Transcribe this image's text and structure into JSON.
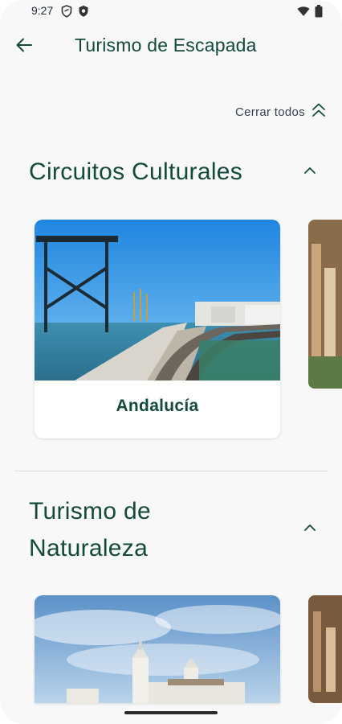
{
  "status_bar": {
    "time": "9:27",
    "icons_left": [
      "vpn-shield-icon",
      "privacy-shield-icon"
    ],
    "icons_right": [
      "wifi-icon",
      "battery-icon"
    ]
  },
  "app_bar": {
    "back_icon": "arrow-left-icon",
    "title": "Turismo de Escapada"
  },
  "collapse_all": {
    "label": "Cerrar todos",
    "icon": "double-chevron-up-icon"
  },
  "sections": [
    {
      "title": "Circuitos Culturales",
      "expanded": true,
      "cards": [
        {
          "label": "Andalucía",
          "image": "pier-seaside-photo"
        }
      ]
    },
    {
      "title_line1": "Turismo de",
      "title_line2": "Naturaleza",
      "expanded": true,
      "cards": [
        {
          "label": "",
          "image": "church-sky-photo"
        }
      ]
    }
  ],
  "colors": {
    "primary": "#134a3c",
    "background": "#f8f8f8",
    "card": "#ffffff"
  }
}
